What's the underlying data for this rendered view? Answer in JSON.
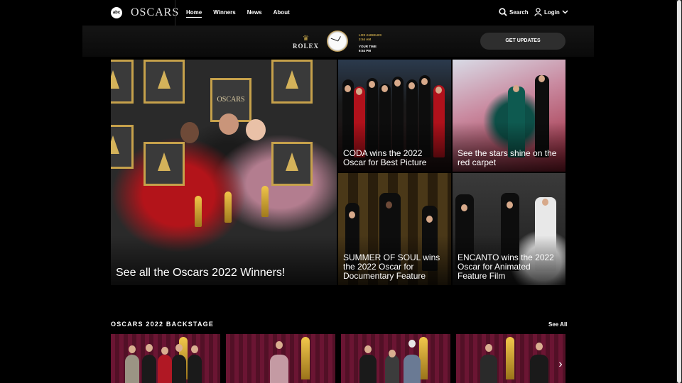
{
  "header": {
    "abc_logo": "abc",
    "oscars_logo": "OSCARS",
    "nav": [
      {
        "label": "Home",
        "active": true
      },
      {
        "label": "Winners",
        "active": false
      },
      {
        "label": "News",
        "active": false
      },
      {
        "label": "About",
        "active": false
      }
    ],
    "search_label": "Search",
    "login_label": "Login"
  },
  "ad": {
    "brand": "ROLEX",
    "city": "LOS ANGELES",
    "city_time": "3:54 AM",
    "your_time_label": "YOUR TIME",
    "your_time": "6:54 PM",
    "button_label": "GET UPDATES"
  },
  "hero": {
    "main_caption": "See all the Oscars 2022 Winners!",
    "panel_text": "OSCARS",
    "tiles": [
      {
        "caption": "CODA wins the 2022 Oscar for Best Picture"
      },
      {
        "caption": "See the stars shine on the red carpet"
      },
      {
        "caption": "SUMMER OF SOUL wins the 2022 Oscar for Documentary Feature"
      },
      {
        "caption": "ENCANTO wins the 2022 Oscar for Animated Feature Film"
      }
    ]
  },
  "backstage": {
    "title": "OSCARS 2022 BACKSTAGE",
    "see_all": "See All"
  },
  "colors": {
    "background": "#000000",
    "gold": "#c7a74a",
    "button": "#2e2e2e"
  }
}
